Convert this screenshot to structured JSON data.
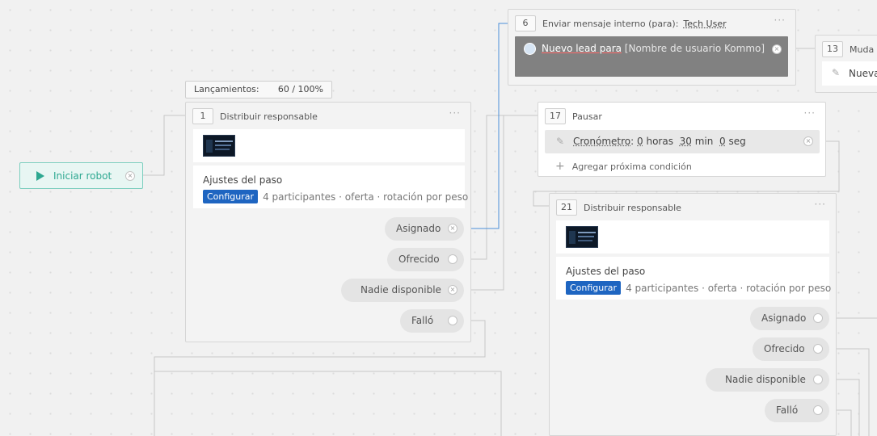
{
  "start": {
    "label": "Iniciar robot",
    "close_glyph": "×"
  },
  "launch": {
    "label": "Lançamientos:",
    "value": "60 / 100%"
  },
  "step1": {
    "number": "1",
    "title": "Distribuir responsable",
    "menu": "···",
    "settings_title": "Ajustes del paso",
    "config_label": "Configurar",
    "summary": "4 participantes · oferta · rotación por peso",
    "outputs": [
      "Asignado",
      "Ofrecido",
      "Nadie disponible",
      "Falló"
    ]
  },
  "step6": {
    "number": "6",
    "title": "Enviar mensaje interno (para):",
    "recipient": "Tech User",
    "menu": "···",
    "message_bold": "Nuevo lead para",
    "message_placeholder": " [Nombre de usuario Kommo]",
    "close_glyph": "×"
  },
  "step13": {
    "number": "13",
    "title": "Muda",
    "content": "Nueva"
  },
  "step17": {
    "number": "17",
    "title": "Pausar",
    "menu": "···",
    "timer_label": "Cronómetro",
    "hours_value": "0",
    "hours_unit": "horas",
    "minutes_value": "30",
    "minutes_unit": "min",
    "seconds_value": "0",
    "seconds_unit": "seg",
    "add_condition": "Agregar próxima condición",
    "close_glyph": "×"
  },
  "step21": {
    "number": "21",
    "title": "Distribuir responsable",
    "menu": "···",
    "settings_title": "Ajustes del paso",
    "config_label": "Configurar",
    "summary": "4 participantes · oferta · rotación por peso",
    "outputs": [
      "Asignado",
      "Ofrecido",
      "Nadie disponible",
      "Falló"
    ]
  },
  "icons": {
    "play": "play-icon",
    "close": "close-icon",
    "pencil": "pencil-icon",
    "plus": "plus-icon",
    "avatar": "avatar-icon"
  },
  "colors": {
    "canvas": "#f1f1f1",
    "start_accent": "#2ea891",
    "config_button": "#1e65c1",
    "active_wire": "#4a90d9",
    "message_card": "#818181"
  }
}
